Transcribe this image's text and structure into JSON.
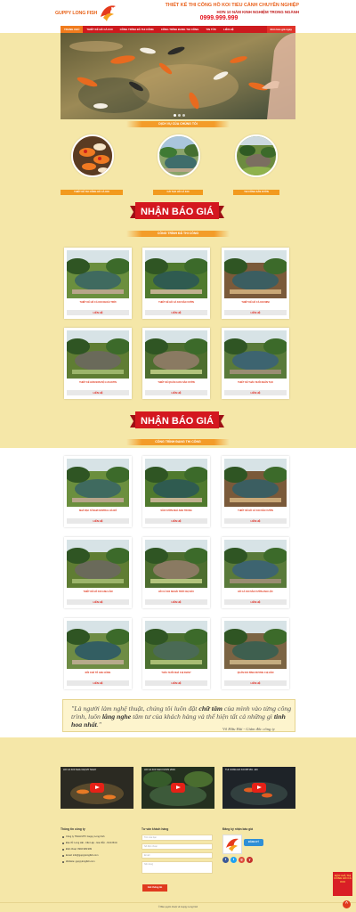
{
  "header": {
    "logo_text": "GUPPY LONG FISH",
    "line1": "THIẾT KẾ THI CÔNG HỒ KOI TIỂU CẢNH CHUYÊN NGHIỆP",
    "line2": "HƠN 10 NĂM KINH NGHIỆM TRONG NGÀNH",
    "phone": "0999.999.999"
  },
  "nav": {
    "items": [
      "TRANG CHỦ",
      "THIẾT KẾ HỒ CÁ KOI",
      "CÔNG TRÌNH ĐÃ THI CÔNG",
      "CÔNG TRÌNH ĐANG THI CÔNG",
      "TIN TỨC",
      "LIÊN HỆ"
    ],
    "cta": "Đơn báo giá ngay"
  },
  "services": {
    "title": "DỊCH VỤ CỦA CHÚNG TÔI",
    "items": [
      "THIẾT KẾ THI CÔNG HỒ CÁ KOI",
      "CẢI TẠO HỒ CÁ KOI",
      "THI CÔNG SÂN VƯỜN"
    ]
  },
  "quote_banner": "NHẬN BÁO GIÁ",
  "done": {
    "title": "CÔNG TRÌNH ĐÃ THI CÔNG",
    "cards": [
      "THIẾT KẾ HỒ CÁ KOI NGOÀI TRỜI",
      "THIẾT KẾ HỒ CÁ KOI SÂN VƯỜN",
      "THIẾT KẾ HỒ CÁ KOI MINI",
      "THIẾT KẾ HÒN NON BỘ LUCAKTIN",
      "THIẾT KẾ QUÁN CAFE SÂN VƯỜN",
      "THIẾT KẾ THÁC SUỐI NHÂN TẠO"
    ],
    "button": "LIÊN HỆ"
  },
  "ongoing": {
    "title": "CÔNG TRÌNH ĐANG THI CÔNG",
    "cards": [
      "NHÀ BẠC SĨ NAM CENTRAL HÀ ĐÔ",
      "SÂN VƯỜN NHÀ ANH TRUNG",
      "THIẾT KẾ HỒ CÁ KOI SÂN VƯỜN",
      "THIẾT KẾ HỒ KOI ANH LÂM",
      "HỒ CÁ KOI NGOÀI TRỜI CHỊ DẦU",
      "HỒ CÁ KOI SÂN VƯỜN ANH LỘC",
      "ĐỒI CHÈ TỐ ANH HÙNG",
      "THÁC SUỐI NHÀ CHỊ DIANY",
      "QUÁN KOI BÌNH DƯƠNG CHỊ HÂN"
    ],
    "button": "LIÊN HỆ"
  },
  "quote": {
    "text_a": "\"Là người làm nghệ thuật, chúng tôi luôn đặt ",
    "em1": "chữ tâm",
    "text_b": " của mình vào từng công trình, luôn ",
    "em2": "lắng nghe",
    "text_c": " tâm tư của khách hàng và thể hiện tất cả những gì ",
    "em3": "tinh hoa nhất",
    "text_d": ".\"",
    "author": "Võ Hữu Hải - Giám đốc công ty"
  },
  "videos": [
    "HỒ CÁ KOI NHÀ CHỊ MỸ NGAY",
    "HỒ CÁ KOI SÂN VƯỜN 2019",
    "THI CÔNG HỒ KOI BT181 - ĐC"
  ],
  "footer": {
    "info_title": "Thông tin công ty",
    "info": [
      "Công ty TNHH MTV Guppy Long Fish",
      "Địa chỉ: Long Hải - Cần Lập - Gia Viễn - Ninh Bình",
      "Điện thoại: 0902.999.999",
      "Email: info@guppylongfish.com",
      "Website: guppylongfish.com"
    ],
    "consult_title": "Tư vấn khách hàng",
    "ph_name": "Tên của bạn",
    "ph_phone": "Số điện thoại",
    "ph_email": "Email",
    "ph_msg": "Nội dung",
    "send": "Gửi thông tin",
    "reg_title": "Đăng ký nhận báo giá",
    "reg_btn": "ĐĂNG KÝ",
    "social": [
      "f",
      "t",
      "g",
      "y"
    ]
  },
  "copyright": "© Bản quyền thuộc về Guppy Long Fish",
  "float_quote": "BÁO GIÁ THI CÔNG HỒ CÁ KOI",
  "colors": {
    "red": "#cd1a1e",
    "orange": "#f29a1e",
    "bg": "#f5e7a8"
  }
}
